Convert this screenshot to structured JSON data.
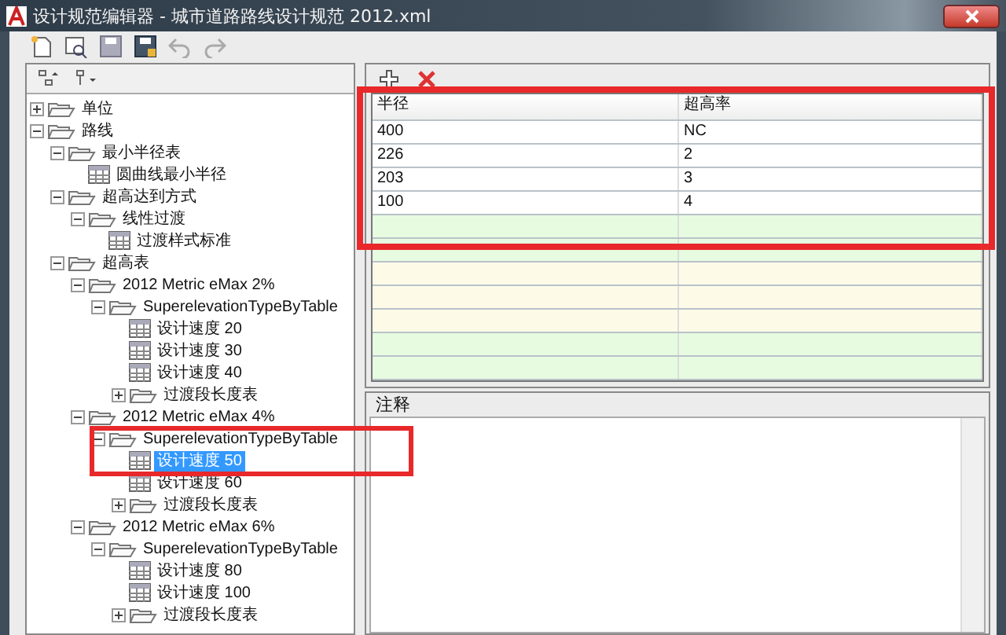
{
  "window": {
    "title": "设计规范编辑器 - 城市道路路线设计规范 2012.xml"
  },
  "tree": [
    {
      "label": "单位",
      "kind": "folder",
      "expanded": false,
      "selected": false
    },
    {
      "label": "路线",
      "kind": "folder",
      "expanded": true,
      "selected": false,
      "children": [
        {
          "label": "最小半径表",
          "kind": "folder",
          "expanded": true,
          "selected": false,
          "children": [
            {
              "label": "圆曲线最小半径",
              "kind": "table",
              "selected": false
            }
          ]
        },
        {
          "label": "超高达到方式",
          "kind": "folder",
          "expanded": true,
          "selected": false,
          "children": [
            {
              "label": "线性过渡",
              "kind": "folder",
              "expanded": true,
              "selected": false,
              "children": [
                {
                  "label": "过渡样式标准",
                  "kind": "table",
                  "selected": false
                }
              ]
            }
          ]
        },
        {
          "label": "超高表",
          "kind": "folder",
          "expanded": true,
          "selected": false,
          "children": [
            {
              "label": "2012 Metric eMax 2%",
              "kind": "folder",
              "expanded": true,
              "selected": false,
              "children": [
                {
                  "label": "SuperelevationTypeByTable",
                  "kind": "folder",
                  "expanded": true,
                  "selected": false,
                  "children": [
                    {
                      "label": "设计速度 20",
                      "kind": "table",
                      "selected": false
                    },
                    {
                      "label": "设计速度 30",
                      "kind": "table",
                      "selected": false
                    },
                    {
                      "label": "设计速度 40",
                      "kind": "table",
                      "selected": false
                    },
                    {
                      "label": "过渡段长度表",
                      "kind": "folder",
                      "expanded": false,
                      "selected": false
                    }
                  ]
                }
              ]
            },
            {
              "label": "2012 Metric eMax 4%",
              "kind": "folder",
              "expanded": true,
              "selected": false,
              "children": [
                {
                  "label": "SuperelevationTypeByTable",
                  "kind": "folder",
                  "expanded": true,
                  "selected": false,
                  "children": [
                    {
                      "label": "设计速度 50",
                      "kind": "table",
                      "selected": true,
                      "highlighted": true
                    },
                    {
                      "label": "设计速度 60",
                      "kind": "table",
                      "selected": false
                    },
                    {
                      "label": "过渡段长度表",
                      "kind": "folder",
                      "expanded": false,
                      "selected": false
                    }
                  ]
                }
              ]
            },
            {
              "label": "2012 Metric eMax 6%",
              "kind": "folder",
              "expanded": true,
              "selected": false,
              "children": [
                {
                  "label": "SuperelevationTypeByTable",
                  "kind": "folder",
                  "expanded": true,
                  "selected": false,
                  "children": [
                    {
                      "label": "设计速度 80",
                      "kind": "table",
                      "selected": false
                    },
                    {
                      "label": "设计速度 100",
                      "kind": "table",
                      "selected": false
                    },
                    {
                      "label": "过渡段长度表",
                      "kind": "folder",
                      "expanded": false,
                      "selected": false
                    }
                  ]
                }
              ]
            }
          ]
        }
      ]
    }
  ],
  "table": {
    "highlighted": true,
    "columns": [
      "半径",
      "超高率"
    ],
    "rows": [
      [
        "400",
        "NC"
      ],
      [
        "226",
        "2"
      ],
      [
        "203",
        "3"
      ],
      [
        "100",
        "4"
      ]
    ]
  },
  "notes": {
    "label": "注释"
  }
}
